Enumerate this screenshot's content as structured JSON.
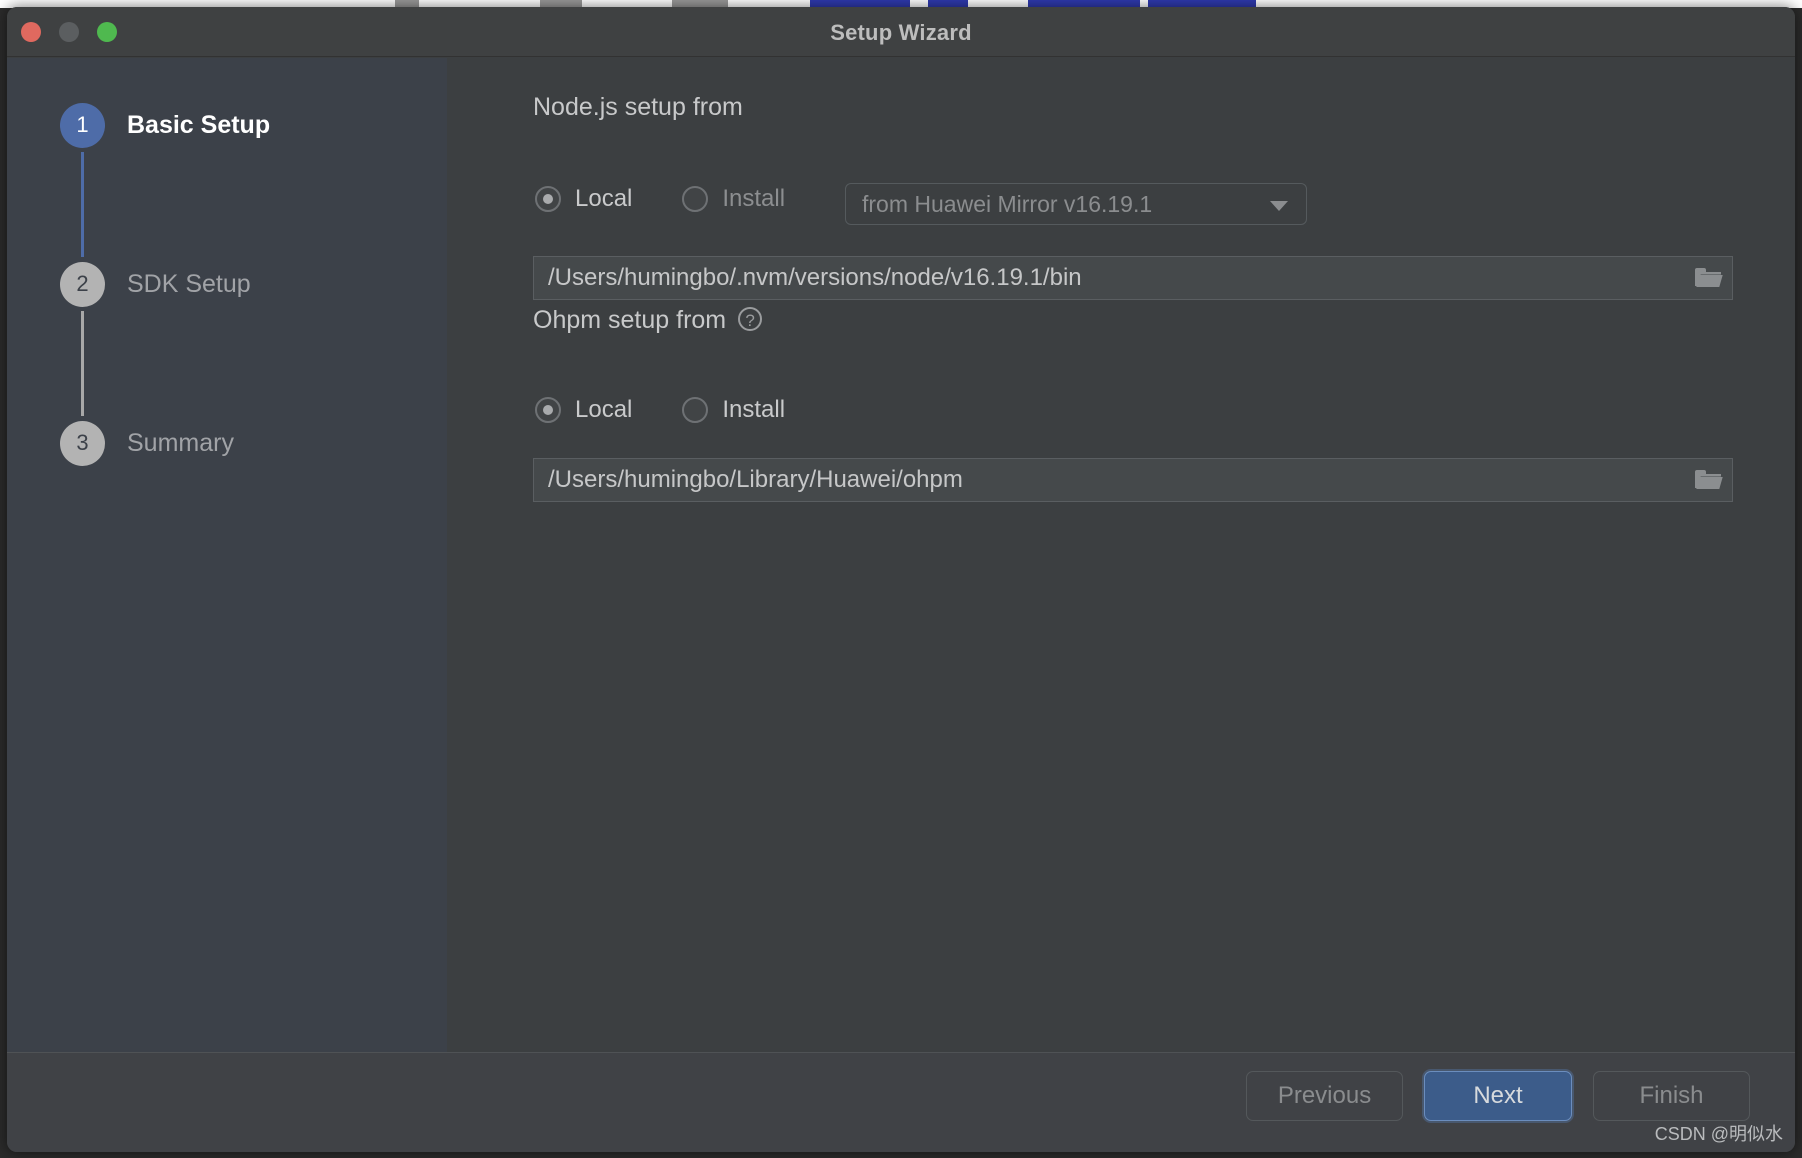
{
  "window": {
    "title": "Setup Wizard",
    "traffic_lights": [
      "close-button",
      "minimize-button",
      "maximize-button"
    ]
  },
  "sidebar": {
    "steps": [
      {
        "number": "1",
        "label": "Basic Setup",
        "state": "active"
      },
      {
        "number": "2",
        "label": "SDK Setup",
        "state": "idle"
      },
      {
        "number": "3",
        "label": "Summary",
        "state": "idle"
      }
    ]
  },
  "main": {
    "nodejs": {
      "title": "Node.js setup from",
      "radios": [
        {
          "label": "Local",
          "checked": true
        },
        {
          "label": "Install",
          "checked": false
        }
      ],
      "mirror_select": {
        "value": "from Huawei Mirror v16.19.1",
        "icon": "chevron-down-icon",
        "enabled": false
      },
      "path": {
        "value": "/Users/humingbo/.nvm/versions/node/v16.19.1/bin",
        "placeholder": "",
        "browse_icon": "folder-icon"
      }
    },
    "ohpm": {
      "title": "Ohpm setup from",
      "help_icon": "help-circle-icon",
      "help_glyph": "?",
      "radios": [
        {
          "label": "Local",
          "checked": true
        },
        {
          "label": "Install",
          "checked": false
        }
      ],
      "path": {
        "value": "/Users/humingbo/Library/Huawei/ohpm",
        "placeholder": "",
        "browse_icon": "folder-icon"
      }
    }
  },
  "footer": {
    "previous_label": "Previous",
    "next_label": "Next",
    "finish_label": "Finish"
  },
  "watermark": "CSDN @明似水",
  "colors": {
    "accent": "#4e6ca8",
    "primary_button": "#3c5c8a",
    "sidebar_bg": "#3c4149",
    "main_bg": "#3c3f41",
    "titlebar_bg": "#3f4142",
    "footer_bg": "#404246",
    "close_dot": "#e0695f",
    "minimize_dot": "#5b5e60",
    "maximize_dot": "#4fb94f"
  }
}
